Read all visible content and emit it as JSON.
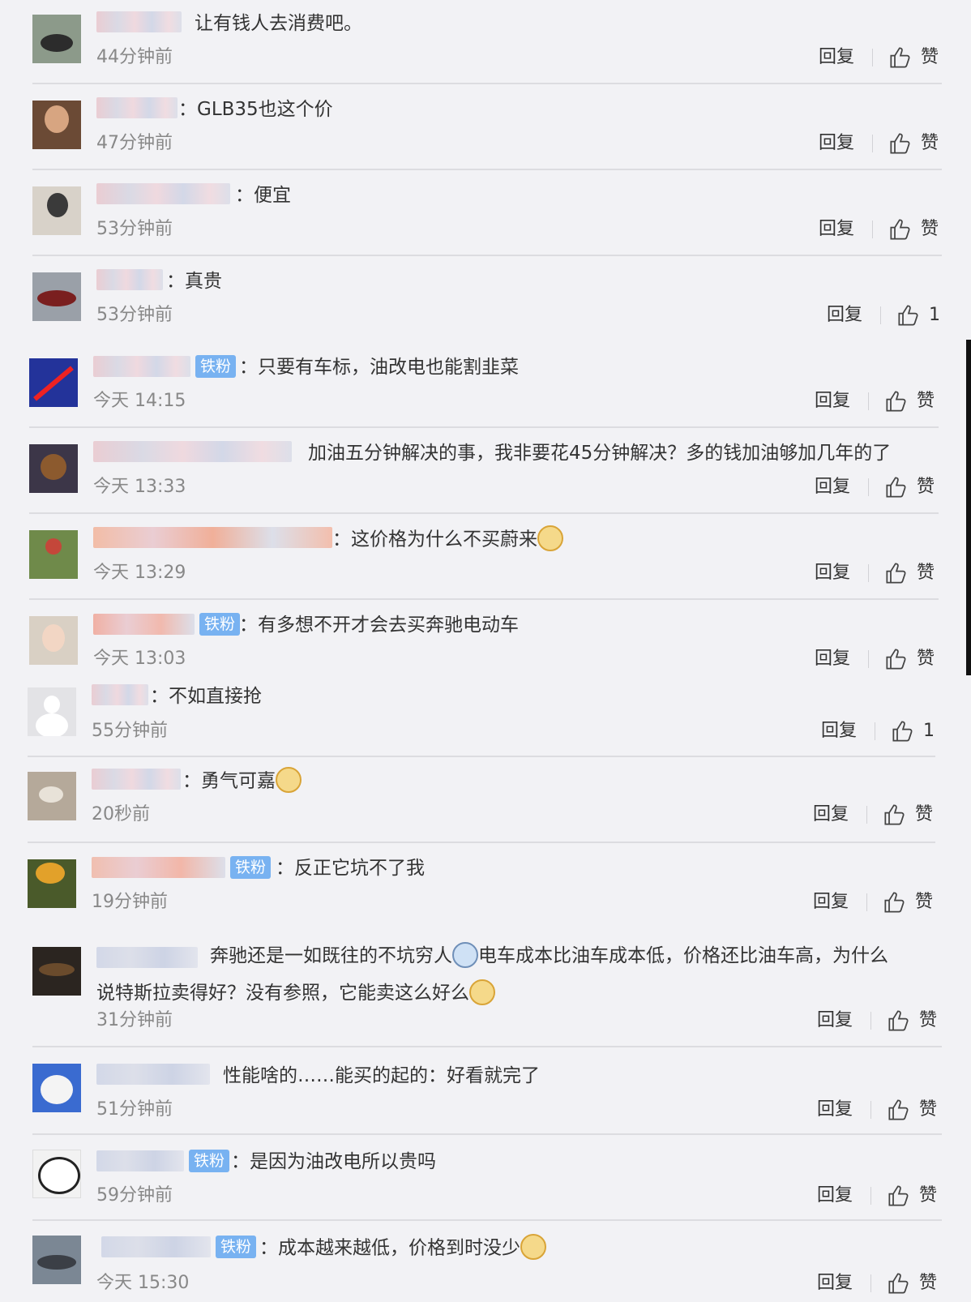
{
  "actions": {
    "reply_label": "回复"
  },
  "comments": [
    {
      "text": "让有钱人去消费吧。",
      "time": "44分钟前",
      "likes": "赞"
    },
    {
      "text": "：GLB35也这个价",
      "time": "47分钟前",
      "likes": "赞"
    },
    {
      "text": "：便宜",
      "time": "53分钟前",
      "likes": "赞"
    },
    {
      "text": "：真贵",
      "time": "53分钟前",
      "likes": "1"
    },
    {
      "badge": "铁粉",
      "text": "：只要有车标，油改电也能割韭菜",
      "time": "今天 14:15",
      "likes": "赞"
    },
    {
      "text": "加油五分钟解决的事，我非要花45分钟解决？多的钱加油够加几年的了",
      "time": "今天 13:33",
      "likes": "赞"
    },
    {
      "text": "：这价格为什么不买蔚来",
      "time": "今天 13:29",
      "likes": "赞"
    },
    {
      "badge": "铁粉",
      "text": "：有多想不开才会去买奔驰电动车",
      "time": "今天 13:03",
      "likes": "赞"
    },
    {
      "text": "：不如直接抢",
      "time": "55分钟前",
      "likes": "1"
    },
    {
      "text": "：勇气可嘉",
      "time": "20秒前",
      "likes": "赞"
    },
    {
      "badge": "铁粉",
      "text": "：反正它坑不了我",
      "time": "19分钟前",
      "likes": "赞"
    },
    {
      "text_a": "奔驰还是一如既往的不坑穷人",
      "text_b": "电车成本比油车成本低，价格还比油车高，为什么说特斯拉卖得好？没有参照，它能卖这么好么",
      "time": "31分钟前",
      "likes": "赞"
    },
    {
      "text": "性能啥的……能买的起的：好看就完了",
      "time": "51分钟前",
      "likes": "赞"
    },
    {
      "badge": "铁粉",
      "text": "：是因为油改电所以贵吗",
      "time": "59分钟前",
      "likes": "赞"
    },
    {
      "badge": "铁粉",
      "text": "：成本越来越低，价格到时没少",
      "time": "今天 15:30",
      "likes": "赞"
    }
  ]
}
